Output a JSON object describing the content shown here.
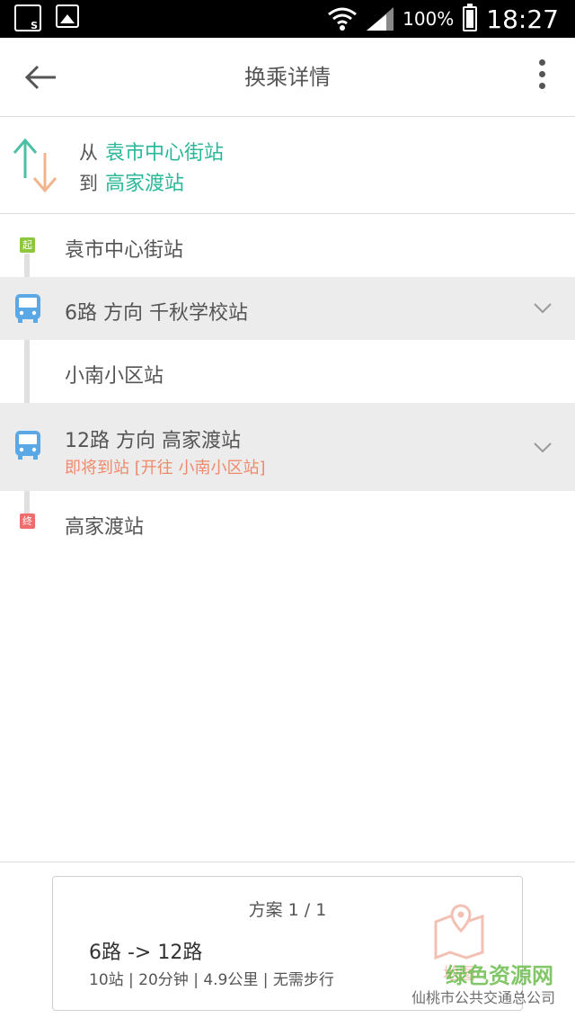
{
  "status_bar": {
    "battery": "100%",
    "time": "18:27"
  },
  "header": {
    "title": "换乘详情"
  },
  "route": {
    "from_label": "从",
    "from_station": "袁市中心街站",
    "to_label": "到",
    "to_station": "高家渡站"
  },
  "steps": [
    {
      "type": "start",
      "badge": "起",
      "text": "袁市中心街站"
    },
    {
      "type": "bus",
      "text": "6路 方向 千秋学校站"
    },
    {
      "type": "stop",
      "text": "小南小区站"
    },
    {
      "type": "bus",
      "text": "12路 方向 高家渡站",
      "status": "即将到站 [开往 小南小区站]"
    },
    {
      "type": "end",
      "badge": "终",
      "text": "高家渡站"
    }
  ],
  "plan": {
    "count": "方案 1 / 1",
    "route": "6路 -> 12路",
    "stats": "10站 | 20分钟 | 4.9公里 | 无需步行",
    "map_label": "地图"
  },
  "watermark": {
    "brand": "绿色资源网",
    "text": "仙桃市公共交通总公司"
  },
  "colors": {
    "accent_green": "#2bb89a",
    "warning_orange": "#f08a6c",
    "bus_blue": "#5aa9e6"
  }
}
